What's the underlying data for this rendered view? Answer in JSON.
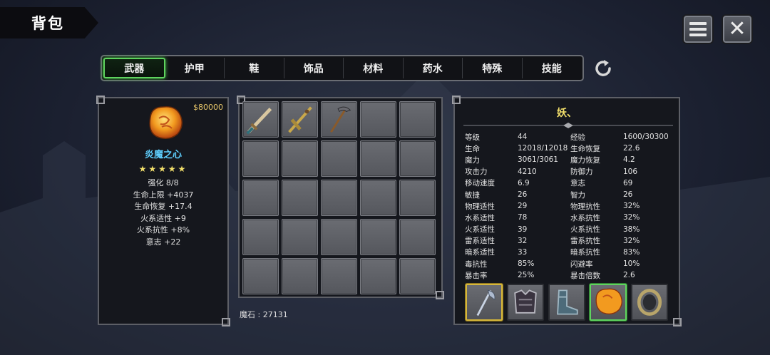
{
  "header": {
    "title": "背包"
  },
  "tabs": [
    {
      "label": "武器",
      "active": true
    },
    {
      "label": "护甲",
      "active": false
    },
    {
      "label": "鞋",
      "active": false
    },
    {
      "label": "饰品",
      "active": false
    },
    {
      "label": "材料",
      "active": false
    },
    {
      "label": "药水",
      "active": false
    },
    {
      "label": "特殊",
      "active": false
    },
    {
      "label": "技能",
      "active": false
    }
  ],
  "item_detail": {
    "price": "$80000",
    "name": "炎魔之心",
    "stars": "★★★★★",
    "star_count": 5,
    "stats": [
      "强化 8/8",
      "生命上限 +4037",
      "生命恢复 +17.4",
      "火系适性 +9",
      "火系抗性 +8%",
      "意志 +22"
    ]
  },
  "inventory": {
    "items": [
      "sword",
      "cross-sword",
      "pickaxe"
    ],
    "slot_count": 25,
    "currency_label": "魔石 : 27131"
  },
  "character": {
    "name": "妖、",
    "stats": [
      [
        "等级",
        "44",
        "经验",
        "1600/30300"
      ],
      [
        "生命",
        "12018/12018",
        "生命恢复",
        "22.6"
      ],
      [
        "魔力",
        "3061/3061",
        "魔力恢复",
        "4.2"
      ],
      [
        "攻击力",
        "4210",
        "防御力",
        "106"
      ],
      [
        "移动速度",
        "6.9",
        "意志",
        "69"
      ],
      [
        "敏捷",
        "26",
        "智力",
        "26"
      ],
      [
        "物理适性",
        "29",
        "物理抗性",
        "32%"
      ],
      [
        "水系适性",
        "78",
        "水系抗性",
        "32%"
      ],
      [
        "火系适性",
        "39",
        "火系抗性",
        "38%"
      ],
      [
        "雷系适性",
        "32",
        "雷系抗性",
        "32%"
      ],
      [
        "暗系适性",
        "33",
        "暗系抗性",
        "83%"
      ],
      [
        "毒抗性",
        "85%",
        "闪避率",
        "10%"
      ],
      [
        "暴击率",
        "25%",
        "暴击倍数",
        "2.6"
      ]
    ],
    "equipment": [
      "axe-icon",
      "armor-icon",
      "boots-icon",
      "fire-stone-icon",
      "ring-icon"
    ]
  },
  "colors": {
    "accent_green": "#5fd35f",
    "gold": "#f3e06b",
    "cyan_name": "#5fd0ff"
  }
}
